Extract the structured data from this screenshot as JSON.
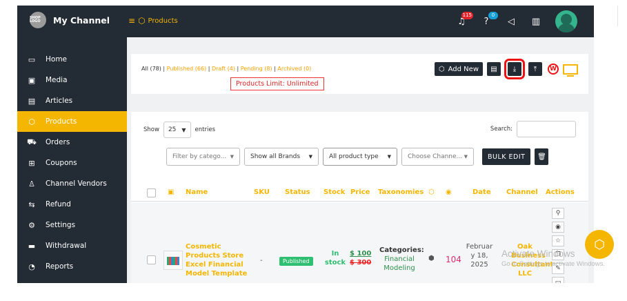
{
  "brand": {
    "logo_text": "SHOP LOGO",
    "title": "My Channel"
  },
  "breadcrumb": {
    "label": "Products"
  },
  "topbar": {
    "notifications_count": "115",
    "help_count": "0"
  },
  "sidebar": {
    "items": [
      {
        "label": "Home",
        "icon": "monitor-icon"
      },
      {
        "label": "Media",
        "icon": "image-icon"
      },
      {
        "label": "Articles",
        "icon": "document-icon"
      },
      {
        "label": "Products",
        "icon": "cube-icon",
        "active": true
      },
      {
        "label": "Orders",
        "icon": "cart-icon"
      },
      {
        "label": "Coupons",
        "icon": "gift-icon"
      },
      {
        "label": "Channel Vendors",
        "icon": "user-icon"
      },
      {
        "label": "Refund",
        "icon": "refund-icon"
      },
      {
        "label": "Settings",
        "icon": "gear-icon"
      },
      {
        "label": "Withdrawal",
        "icon": "card-icon"
      },
      {
        "label": "Reports",
        "icon": "chart-icon"
      }
    ]
  },
  "status_filters": {
    "all": "All (78)",
    "published": "Published (66)",
    "draft": "Draft (4)",
    "pending": "Pending (8)",
    "archived": "Archived (0)",
    "sep": " | "
  },
  "products_limit": "Products Limit: Unlimited",
  "toolbar": {
    "add_new": "Add New"
  },
  "table_controls": {
    "show_label": "Show",
    "entries_value": "25",
    "entries_label": "entries",
    "search_label": "Search:"
  },
  "filters": {
    "category": "Filter by catego...",
    "brands": "Show all Brands",
    "product_type": "All product type",
    "channel": "Choose Channe...",
    "bulk_edit": "BULK EDIT"
  },
  "columns": {
    "name": "Name",
    "sku": "SKU",
    "status": "Status",
    "stock": "Stock",
    "price": "Price",
    "taxonomies": "Taxonomies",
    "date": "Date",
    "channel": "Channel",
    "actions": "Actions"
  },
  "rows": [
    {
      "name": "Cosmetic Products Store Excel Financial Model Template",
      "sku": "-",
      "status": "Published",
      "stock_line1": "In",
      "stock_line2": "stock",
      "price_new": "$ 100",
      "price_old": "$ 300",
      "tax_label": "Categories:",
      "tax_value": "Financial Modeling",
      "views": "104",
      "date": "Februar y 18, 2025",
      "channel": "Oak Business Consultant LLC"
    }
  ],
  "watermark": {
    "line1": "Activate Windows",
    "line2": "Go to Settings to activate Windows."
  }
}
